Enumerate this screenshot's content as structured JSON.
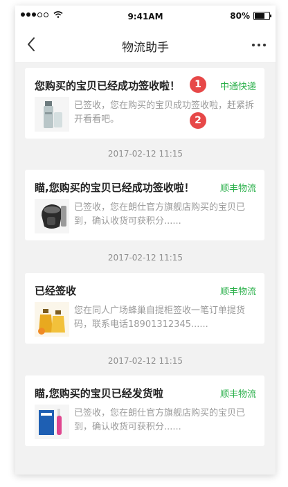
{
  "status": {
    "time": "9:41AM",
    "battery": "80%",
    "battery_level": 0.8
  },
  "nav": {
    "title": "物流助手"
  },
  "badges": [
    "1",
    "2"
  ],
  "cards": [
    {
      "title": "您购买的宝贝已经成功签收啦！",
      "carrier": "中通快递",
      "text": "已签收，您在购买的宝贝成功签收啦，赶紧拆开看看吧。",
      "thumb": "skincare-bottle-thumbnail"
    },
    {
      "title": "瞄,您购买的宝贝已经成功签收啦！",
      "carrier": "顺丰物流",
      "text": "已签收，您在朗仕官方旗舰店购买的宝贝已到，确认收货可获积分......",
      "thumb": "electric-shaver-thumbnail"
    },
    {
      "title": "已经签收",
      "carrier": "顺丰物流",
      "text": "您在同人广场蜂巢自提柜签收一笔订单提货码，联系电话18901312345......",
      "thumb": "honey-bottles-thumbnail"
    },
    {
      "title": "瞄,您购买的宝贝已经发货啦",
      "carrier": "顺丰物流",
      "text": "已签收，您在朗仕官方旗舰店购买的宝贝已到，确认收货可获积分......",
      "thumb": "electric-toothbrush-thumbnail"
    }
  ],
  "times": [
    "2017-02-12 11:15",
    "2017-02-12 11:15",
    "2017-02-12 11:15"
  ],
  "colors": {
    "accent_green": "#2bb04b",
    "badge_red": "#e74848",
    "background": "#f2f2f2"
  }
}
